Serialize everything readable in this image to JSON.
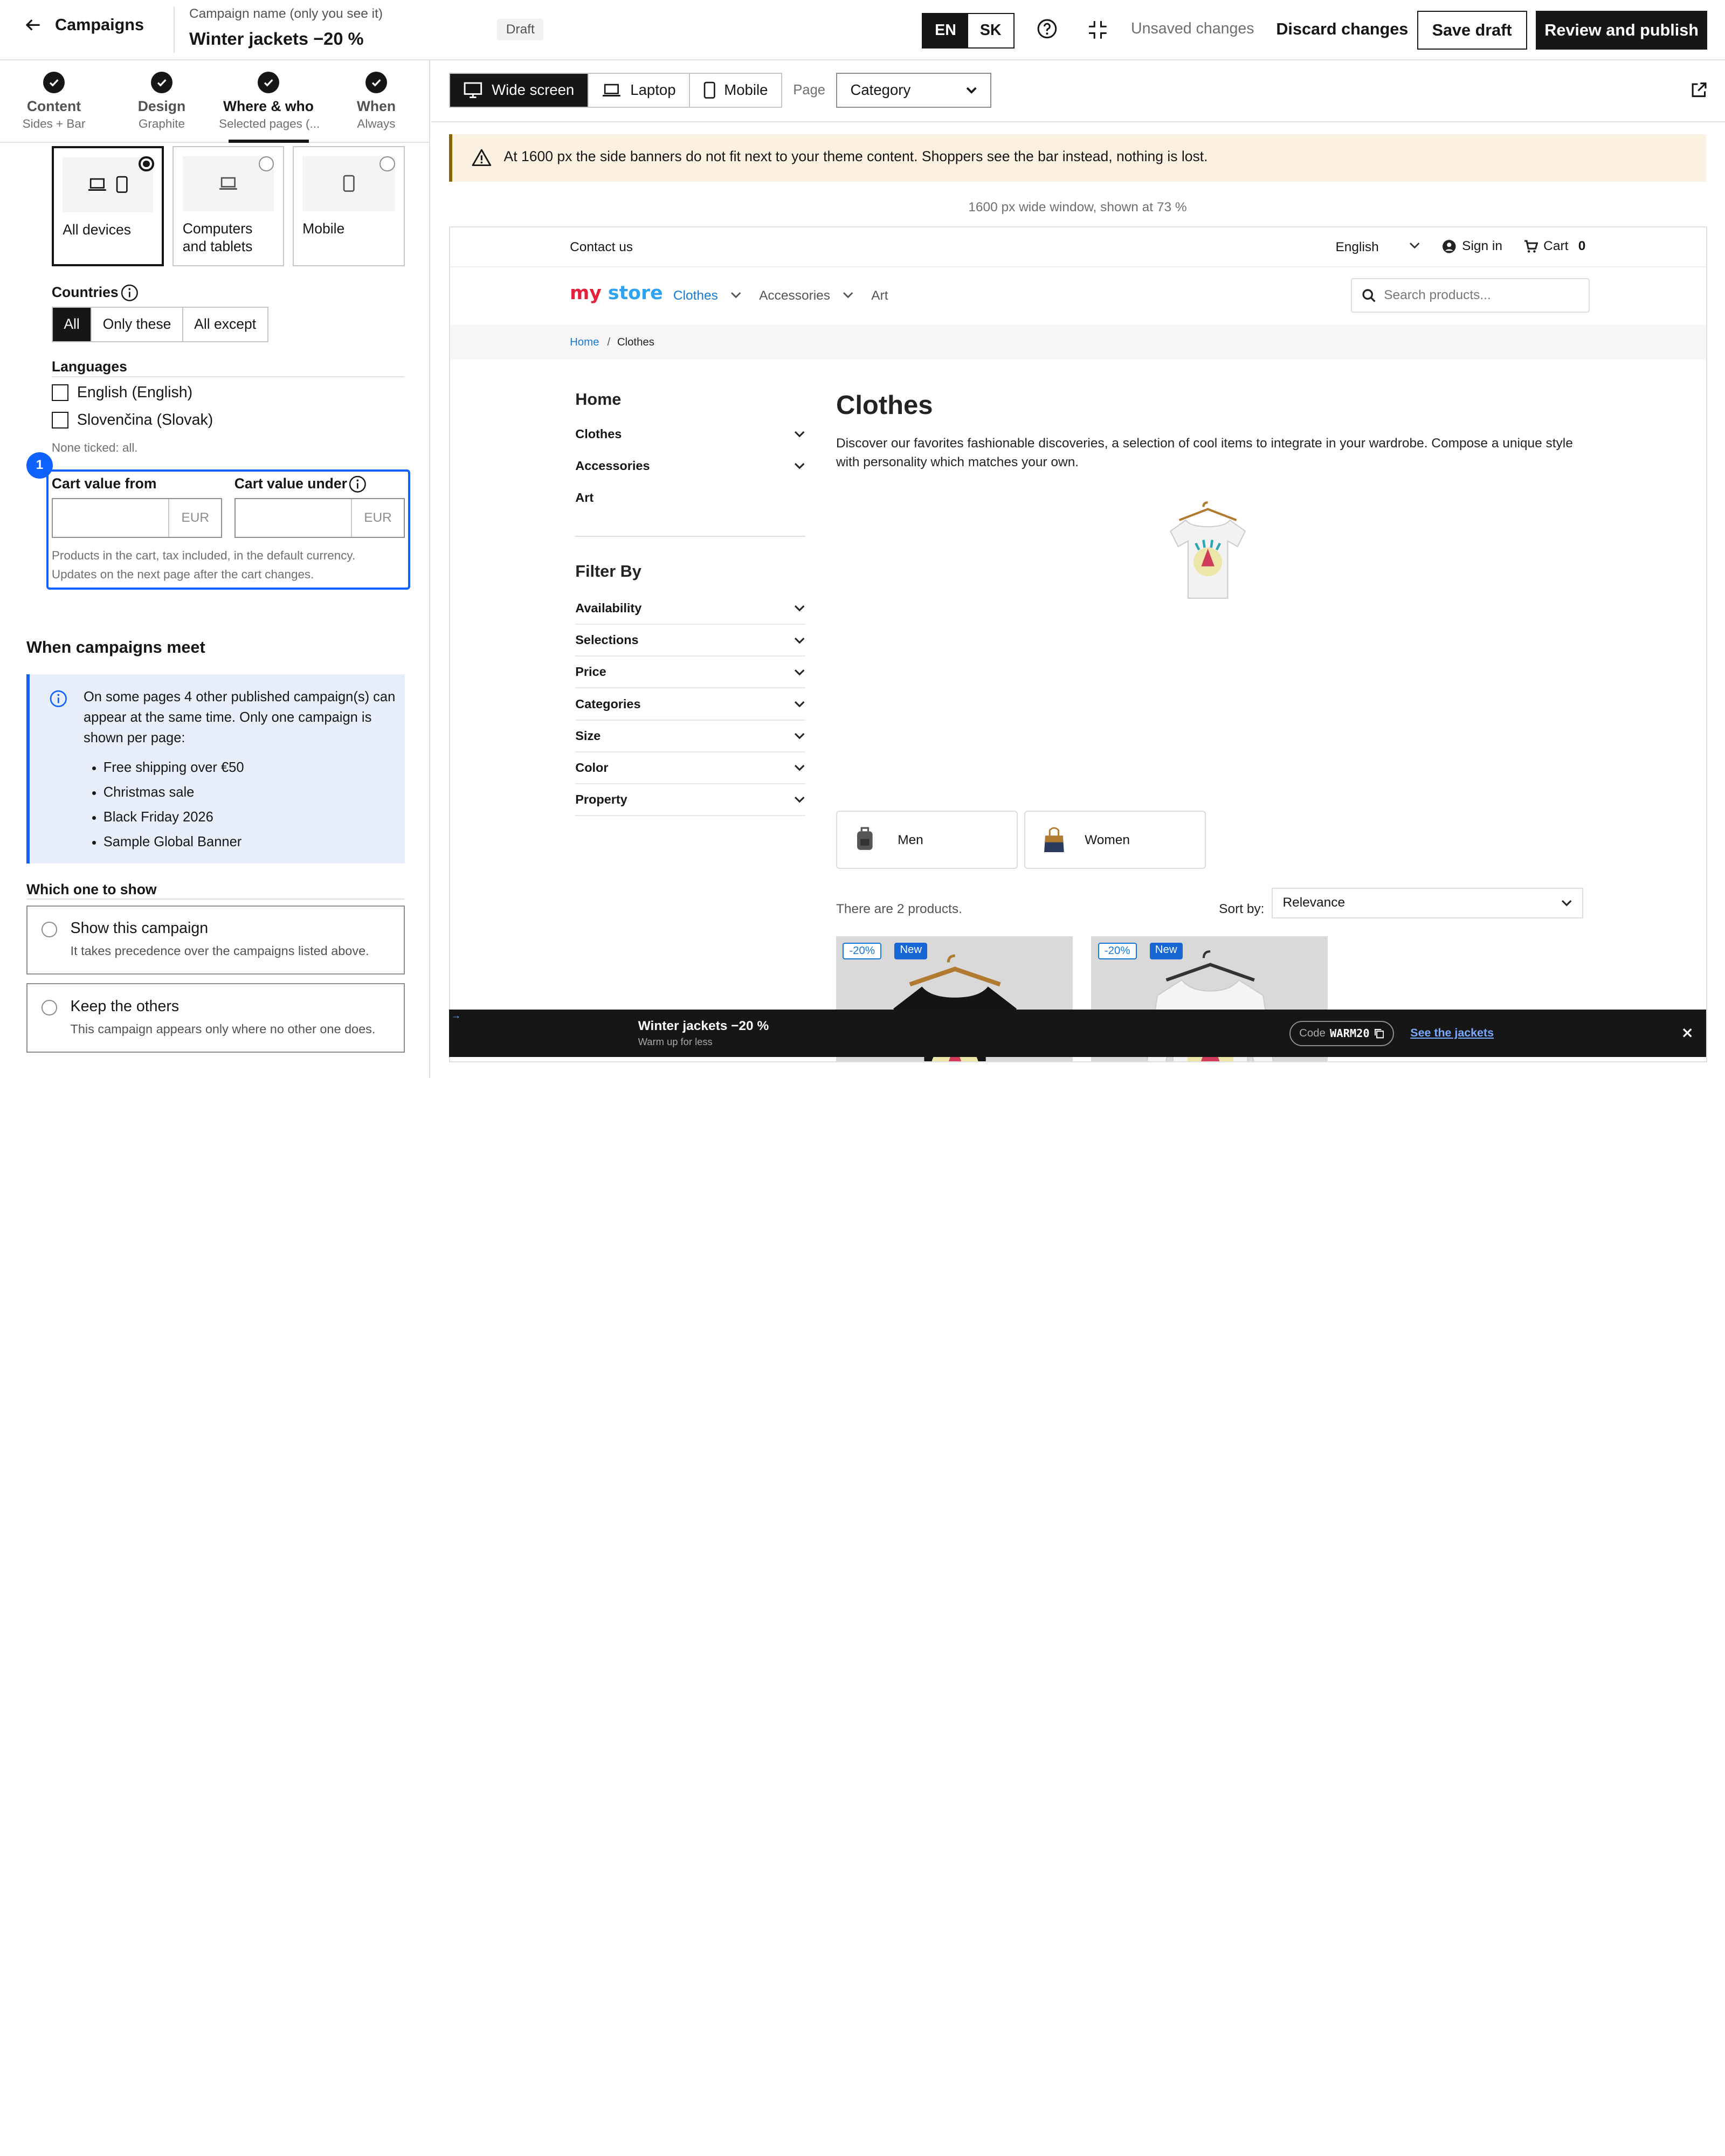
{
  "topbar": {
    "back_label": "Campaigns",
    "campaign_name_label": "Campaign name (only you see it)",
    "campaign_name": "Winter jackets −20 %",
    "status": "Draft",
    "languages": [
      "EN",
      "SK"
    ],
    "active_language": "EN",
    "unsaved": "Unsaved changes",
    "discard": "Discard changes",
    "save_draft": "Save draft",
    "publish": "Review and publish"
  },
  "steps": [
    {
      "title": "Content",
      "sub": "Sides + Bar"
    },
    {
      "title": "Design",
      "sub": "Graphite"
    },
    {
      "title": "Where & who",
      "sub": "Selected pages (..."
    },
    {
      "title": "When",
      "sub": "Always"
    }
  ],
  "devices": {
    "options": [
      "All devices",
      "Computers\nand tablets",
      "Mobile"
    ],
    "selected": "All devices"
  },
  "countries": {
    "label": "Countries",
    "options": [
      "All",
      "Only these",
      "All except"
    ],
    "selected": "All"
  },
  "languages": {
    "label": "Languages",
    "options": [
      "English (English)",
      "Slovenčina (Slovak)"
    ],
    "hint": "None ticked: all."
  },
  "cart": {
    "step": "1",
    "from_label": "Cart value from",
    "under_label": "Cart value under",
    "currency": "EUR",
    "hint_1": "Products in the cart, tax included, in the default currency.",
    "hint_2": "Updates on the next page after the cart changes."
  },
  "conflicts": {
    "heading": "When campaigns meet",
    "info": "On some pages 4 other published campaign(s) can appear at the same time. Only one campaign is shown per page:",
    "campaigns": [
      "Free shipping over €50",
      "Christmas sale",
      "Black Friday 2026",
      "Sample Global Banner"
    ],
    "which_label": "Which one to show",
    "options": [
      {
        "title": "Show this campaign",
        "desc": "It takes precedence over the campaigns listed above."
      },
      {
        "title": "Keep the others",
        "desc": "This campaign appears only where no other one does."
      }
    ]
  },
  "preview": {
    "devices": [
      "Wide screen",
      "Laptop",
      "Mobile"
    ],
    "active_device": "Wide screen",
    "page_label": "Page",
    "page_value": "Category",
    "warning": "At 1600 px the side banners do not fit next to your theme content. Shoppers see the bar instead, nothing is lost.",
    "scale_note": "1600 px wide window, shown at 73 %"
  },
  "store": {
    "contact": "Contact us",
    "language": "English",
    "sign_in": "Sign in",
    "cart_label": "Cart",
    "cart_count": "0",
    "logo_my": "my",
    "logo_store": "store",
    "nav": [
      "Clothes",
      "Accessories",
      "Art"
    ],
    "search_placeholder": "Search products...",
    "breadcrumb": [
      "Home",
      "Clothes"
    ],
    "side_home": "Home",
    "side_cats": [
      "Clothes",
      "Accessories",
      "Art"
    ],
    "filter_by": "Filter By",
    "filters": [
      "Availability",
      "Selections",
      "Price",
      "Categories",
      "Size",
      "Color",
      "Property"
    ],
    "title": "Clothes",
    "description": "Discover our favorites fashionable discoveries, a selection of cool items to integrate in your wardrobe. Compose a unique style with personality which matches your own.",
    "subcats": [
      "Men",
      "Women"
    ],
    "count": "There are 2 products.",
    "sort_label": "Sort by:",
    "sort_value": "Relevance",
    "discount_tag": "-20%",
    "new_tag": "New"
  },
  "bar": {
    "title": "Winter jackets −20 %",
    "subtitle": "Warm up for less",
    "code_label": "Code",
    "code": "WARM20",
    "cta": "See the jackets"
  },
  "colors": {
    "accent": "#0f62fe",
    "dark": "#161616",
    "warning_bg": "#fcf1e1",
    "info_bg": "#e8edfa"
  }
}
